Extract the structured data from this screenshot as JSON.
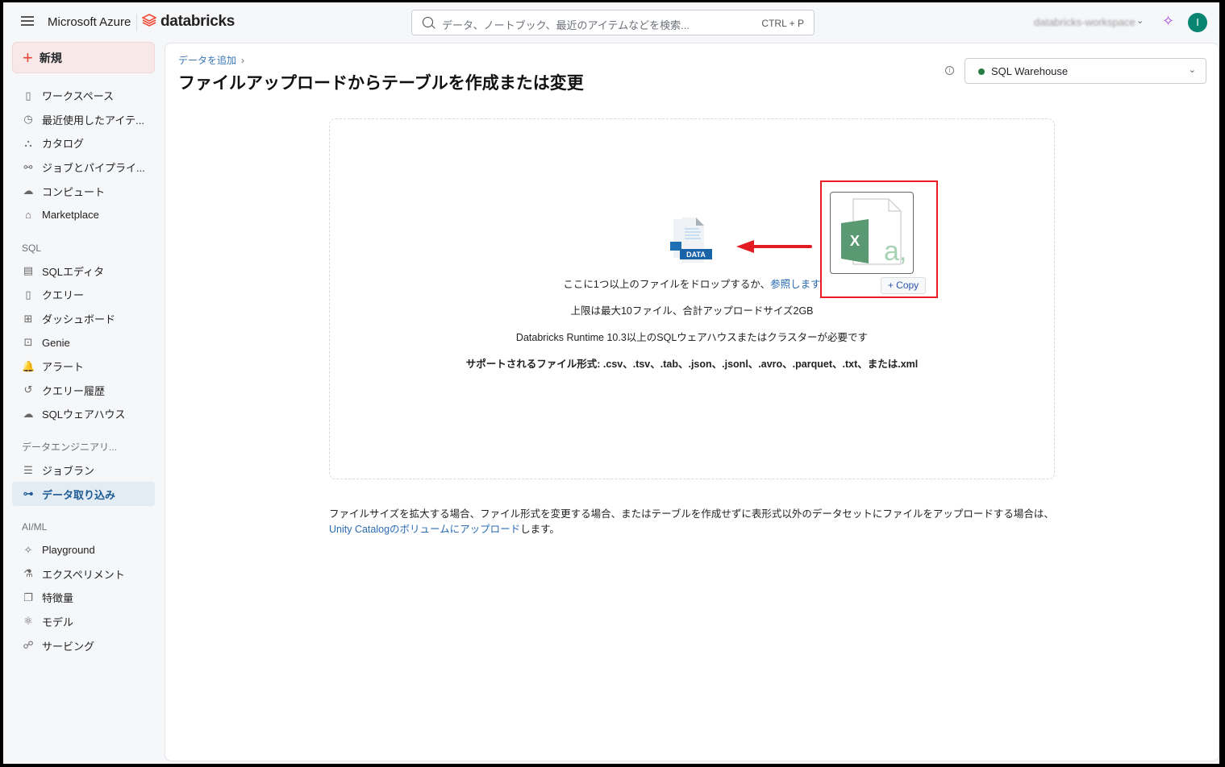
{
  "header": {
    "brand": "Microsoft Azure",
    "product": "databricks",
    "search_placeholder": "データ、ノートブック、最近のアイテムなどを検索...",
    "search_shortcut": "CTRL + P",
    "workspace": "databricks-workspace",
    "avatar_initial": "I"
  },
  "sidebar": {
    "new_label": "新規",
    "items": [
      {
        "label": "ワークスペース",
        "icon": "▯"
      },
      {
        "label": "最近使用したアイテ...",
        "icon": "◷"
      },
      {
        "label": "カタログ",
        "icon": "⛬"
      },
      {
        "label": "ジョブとパイプライ...",
        "icon": "⚯"
      },
      {
        "label": "コンピュート",
        "icon": "☁"
      },
      {
        "label": "Marketplace",
        "icon": "⌂"
      }
    ],
    "sql_header": "SQL",
    "sql_items": [
      {
        "label": "SQLエディタ",
        "icon": "▤"
      },
      {
        "label": "クエリー",
        "icon": "▯"
      },
      {
        "label": "ダッシュボード",
        "icon": "⊞"
      },
      {
        "label": "Genie",
        "icon": "⊡"
      },
      {
        "label": "アラート",
        "icon": "🔔"
      },
      {
        "label": "クエリー履歴",
        "icon": "↺"
      },
      {
        "label": "SQLウェアハウス",
        "icon": "☁"
      }
    ],
    "de_header": "データエンジニアリ...",
    "de_items": [
      {
        "label": "ジョブラン",
        "icon": "☰"
      },
      {
        "label": "データ取り込み",
        "icon": "⊶"
      }
    ],
    "ml_header": "AI/ML",
    "ml_items": [
      {
        "label": "Playground",
        "icon": "✧"
      },
      {
        "label": "エクスペリメント",
        "icon": "⚗"
      },
      {
        "label": "特徴量",
        "icon": "❐"
      },
      {
        "label": "モデル",
        "icon": "⚛"
      },
      {
        "label": "サービング",
        "icon": "☍"
      }
    ]
  },
  "main": {
    "breadcrumb": "データを追加",
    "title": "ファイルアップロードからテーブルを作成または変更",
    "warehouse": "SQL Warehouse",
    "drop_text": "ここに1つ以上のファイルをドロップするか、",
    "browse_link": "参照します",
    "limit_text": "上限は最大10ファイル、合計アップロードサイズ2GB",
    "runtime_text": "Databricks Runtime 10.3以上のSQLウェアハウスまたはクラスターが必要です",
    "formats_label": "サポートされるファイル形式:",
    "formats": ".csv、.tsv、.tab、.json、.jsonl、.avro、.parquet、.txt、または.xml",
    "data_icon_label": "DATA",
    "copy_label": "Copy",
    "excel_letter": "X",
    "footer_text": "ファイルサイズを拡大する場合、ファイル形式を変更する場合、またはテーブルを作成せずに表形式以外のデータセットにファイルをアップロードする場合は、",
    "footer_link": "Unity Catalogのボリュームにアップロード",
    "footer_end": "します。"
  }
}
